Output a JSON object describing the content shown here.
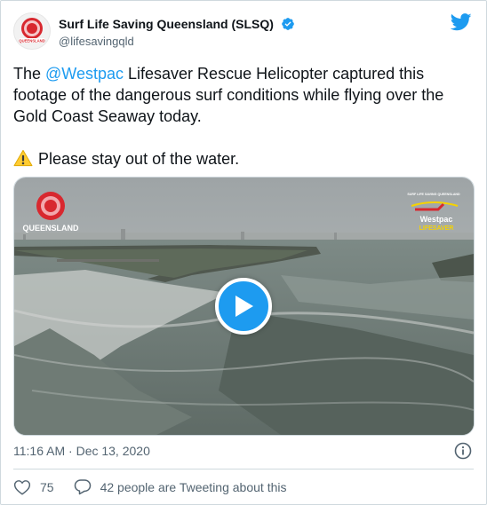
{
  "author": {
    "name": "Surf Life Saving Queensland (SLSQ)",
    "handle": "@lifesavingqld",
    "avatar_text": "QUEENSLAND"
  },
  "tweet": {
    "text_prefix": "The ",
    "mention": "@Westpac",
    "text_rest": " Lifesaver Rescue Helicopter captured this footage of the dangerous surf conditions while flying over the Gold Coast Seaway today.",
    "warning_text": "Please stay out of the water."
  },
  "media": {
    "type": "video",
    "overlay_left_text": "QUEENSLAND",
    "overlay_right_brand": "Westpac",
    "overlay_right_sub": "LIFESAVER",
    "overlay_right_top": "SURF LIFE SAVING QUEENSLAND"
  },
  "meta": {
    "time": "11:16 AM",
    "separator": " · ",
    "date": "Dec 13, 2020"
  },
  "actions": {
    "likes": "75",
    "conversation": "42 people are Tweeting about this"
  },
  "colors": {
    "accent": "#1d9bf0",
    "text_primary": "#0f1419",
    "text_secondary": "#536471",
    "like_icon": "heart-icon",
    "reply_icon": "speech-bubble-icon"
  }
}
